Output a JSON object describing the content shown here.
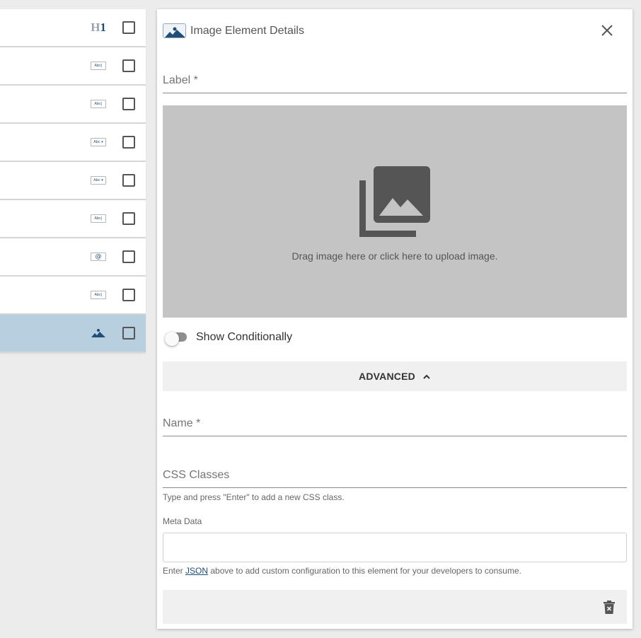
{
  "element_list": {
    "rows": [
      {
        "type": "heading",
        "icon": "h1-icon",
        "text_a": "H",
        "text_b": "1"
      },
      {
        "type": "text-input",
        "icon": "text-input-icon",
        "text_a": "Abc|"
      },
      {
        "type": "text-input",
        "icon": "text-input-icon",
        "text_a": "Abc|"
      },
      {
        "type": "dropdown",
        "icon": "dropdown-icon",
        "text_a": "Abc",
        "text_b": "▾"
      },
      {
        "type": "dropdown",
        "icon": "dropdown-icon",
        "text_a": "Abc",
        "text_b": "▾"
      },
      {
        "type": "text-input",
        "icon": "text-input-icon",
        "text_a": "Abc|"
      },
      {
        "type": "email",
        "icon": "email-icon",
        "text_a": "@"
      },
      {
        "type": "text-input",
        "icon": "text-input-icon",
        "text_a": "Abc|"
      },
      {
        "type": "image",
        "icon": "image-icon",
        "selected": true
      }
    ]
  },
  "panel": {
    "title": "Image Element Details",
    "label_field": {
      "label": "Label *",
      "value": ""
    },
    "upload": {
      "text": "Drag image here or click here to upload image."
    },
    "show_conditionally": {
      "label": "Show Conditionally",
      "enabled": false
    },
    "advanced": {
      "label": "ADVANCED",
      "expanded": true
    },
    "name_field": {
      "label": "Name *",
      "value": ""
    },
    "css_field": {
      "label": "CSS Classes",
      "value": "",
      "hint": "Type and press \"Enter\" to add a new CSS class."
    },
    "meta": {
      "label": "Meta Data",
      "value": "",
      "hint_prefix": "Enter ",
      "hint_link": "JSON",
      "hint_suffix": " above to add custom configuration to this element for your developers to consume."
    }
  },
  "colors": {
    "accent": "#1f4e79",
    "selected_row": "#b7cfdf",
    "upload_bg": "#c4c4c4",
    "background": "#ececec"
  }
}
